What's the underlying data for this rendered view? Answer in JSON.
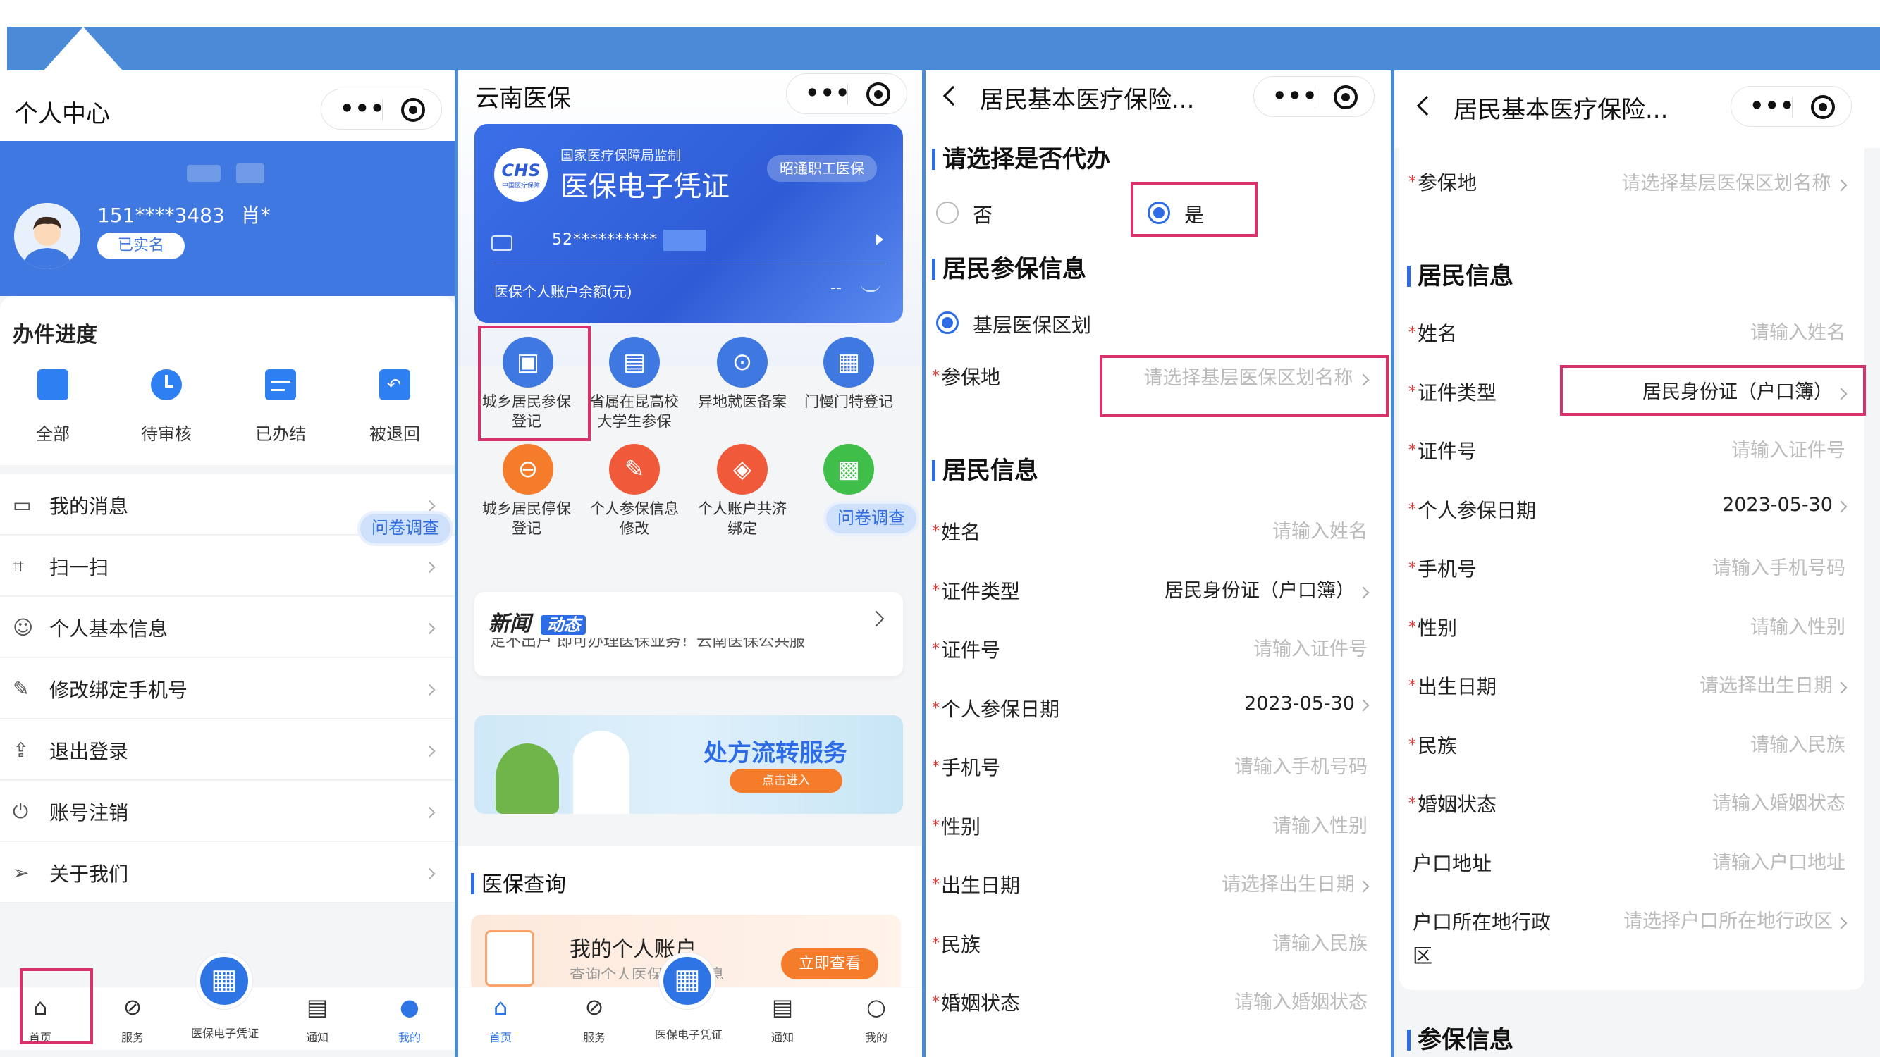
{
  "colors": {
    "primary": "#3f78e0",
    "highlight": "#d9316a",
    "accent_orange": "#f57c2b"
  },
  "panel1": {
    "title": "个人中心",
    "phone": "151****3483",
    "name": "肖*",
    "verified_badge": "已实名",
    "progress_title": "办件进度",
    "progress_items": [
      {
        "label": "全部",
        "icon": "folder-icon"
      },
      {
        "label": "待审核",
        "icon": "clock-icon"
      },
      {
        "label": "已办结",
        "icon": "check-doc-icon"
      },
      {
        "label": "被退回",
        "icon": "return-icon"
      }
    ],
    "menu": [
      {
        "label": "我的消息",
        "icon": "message-icon"
      },
      {
        "label": "扫一扫",
        "icon": "scan-icon"
      },
      {
        "label": "个人基本信息",
        "icon": "user-icon"
      },
      {
        "label": "修改绑定手机号",
        "icon": "edit-phone-icon"
      },
      {
        "label": "退出登录",
        "icon": "logout-icon"
      },
      {
        "label": "账号注销",
        "icon": "power-icon"
      },
      {
        "label": "关于我们",
        "icon": "send-icon"
      }
    ],
    "survey": "问卷调查",
    "tabs": [
      "首页",
      "服务",
      "医保电子凭证",
      "通知",
      "我的"
    ]
  },
  "panel2": {
    "title": "云南医保",
    "card_org": "国家医疗保障局监制",
    "card_logo": "CHS",
    "card_logo_sub": "中国医疗保障",
    "card_title": "医保电子凭证",
    "card_tag": "昭通职工医保",
    "card_number": "52**********",
    "card_balance_label": "医保个人账户余额(元)",
    "card_balance_value": "--",
    "services": [
      {
        "label": "城乡居民参保\n登记",
        "color": "#3f78e0",
        "icon": "register-icon"
      },
      {
        "label": "省属在昆高校\n大学生参保",
        "color": "#3f78e0",
        "icon": "student-icon"
      },
      {
        "label": "异地就医备案",
        "color": "#3f78e0",
        "icon": "location-icon"
      },
      {
        "label": "门慢门特登记",
        "color": "#3f78e0",
        "icon": "calendar-icon"
      },
      {
        "label": "城乡居民停保\n登记",
        "color": "#f57c2b",
        "icon": "stop-icon"
      },
      {
        "label": "个人参保信息\n修改",
        "color": "#f05a3a",
        "icon": "edit-icon"
      },
      {
        "label": "个人账户共济\n绑定",
        "color": "#f05a3a",
        "icon": "link-icon"
      },
      {
        "label": "",
        "color": "#3fbf4a",
        "icon": "grid-icon"
      }
    ],
    "survey": "问卷调查",
    "news_title": "新闻",
    "news_tag": "动态",
    "news_text": "足不出户 即可办理医保业务！云南医保公共服",
    "banner_title": "处方流转服务",
    "banner_button": "点击进入",
    "query_title": "医保查询",
    "account_title": "我的个人账户",
    "account_sub": "查询个人医保账户信息",
    "account_btn": "立即查看",
    "tabs": [
      "首页",
      "服务",
      "医保电子凭证",
      "通知",
      "我的"
    ]
  },
  "panel3": {
    "title": "居民基本医疗保险...",
    "agent_title": "请选择是否代办",
    "agent_options": [
      "否",
      "是"
    ],
    "insure_title": "居民参保信息",
    "region_option": "基层医保区划",
    "fields_top": [
      {
        "label": "参保地",
        "value": "请选择基层医保区划名称",
        "required": true,
        "chevron": true,
        "filled": false
      }
    ],
    "resident_title": "居民信息",
    "fields": [
      {
        "label": "姓名",
        "value": "请输入姓名",
        "required": true,
        "chevron": false,
        "filled": false
      },
      {
        "label": "证件类型",
        "value": "居民身份证（户口簿）",
        "required": true,
        "chevron": true,
        "filled": true
      },
      {
        "label": "证件号",
        "value": "请输入证件号",
        "required": true,
        "chevron": false,
        "filled": false
      },
      {
        "label": "个人参保日期",
        "value": "2023-05-30",
        "required": true,
        "chevron": true,
        "filled": true
      },
      {
        "label": "手机号",
        "value": "请输入手机号码",
        "required": true,
        "chevron": false,
        "filled": false
      },
      {
        "label": "性别",
        "value": "请输入性别",
        "required": true,
        "chevron": false,
        "filled": false
      },
      {
        "label": "出生日期",
        "value": "请选择出生日期",
        "required": true,
        "chevron": true,
        "filled": false
      },
      {
        "label": "民族",
        "value": "请输入民族",
        "required": true,
        "chevron": false,
        "filled": false
      },
      {
        "label": "婚姻状态",
        "value": "请输入婚姻状态",
        "required": true,
        "chevron": false,
        "filled": false
      }
    ]
  },
  "panel4": {
    "title": "居民基本医疗保险...",
    "fields_top": [
      {
        "label": "参保地",
        "value": "请选择基层医保区划名称",
        "required": true,
        "chevron": true,
        "filled": false
      }
    ],
    "resident_title": "居民信息",
    "fields": [
      {
        "label": "姓名",
        "value": "请输入姓名",
        "required": true,
        "chevron": false,
        "filled": false
      },
      {
        "label": "证件类型",
        "value": "居民身份证（户口簿）",
        "required": true,
        "chevron": true,
        "filled": true
      },
      {
        "label": "证件号",
        "value": "请输入证件号",
        "required": true,
        "chevron": false,
        "filled": false
      },
      {
        "label": "个人参保日期",
        "value": "2023-05-30",
        "required": true,
        "chevron": true,
        "filled": true
      },
      {
        "label": "手机号",
        "value": "请输入手机号码",
        "required": true,
        "chevron": false,
        "filled": false
      },
      {
        "label": "性别",
        "value": "请输入性别",
        "required": true,
        "chevron": false,
        "filled": false
      },
      {
        "label": "出生日期",
        "value": "请选择出生日期",
        "required": true,
        "chevron": true,
        "filled": false
      },
      {
        "label": "民族",
        "value": "请输入民族",
        "required": true,
        "chevron": false,
        "filled": false
      },
      {
        "label": "婚姻状态",
        "value": "请输入婚姻状态",
        "required": true,
        "chevron": false,
        "filled": false
      },
      {
        "label": "户口地址",
        "value": "请输入户口地址",
        "required": false,
        "chevron": false,
        "filled": false
      },
      {
        "label": "户口所在地行政\n区",
        "value": "请选择户口所在地行政区",
        "required": false,
        "chevron": true,
        "filled": false
      }
    ],
    "insure_title": "参保信息"
  }
}
